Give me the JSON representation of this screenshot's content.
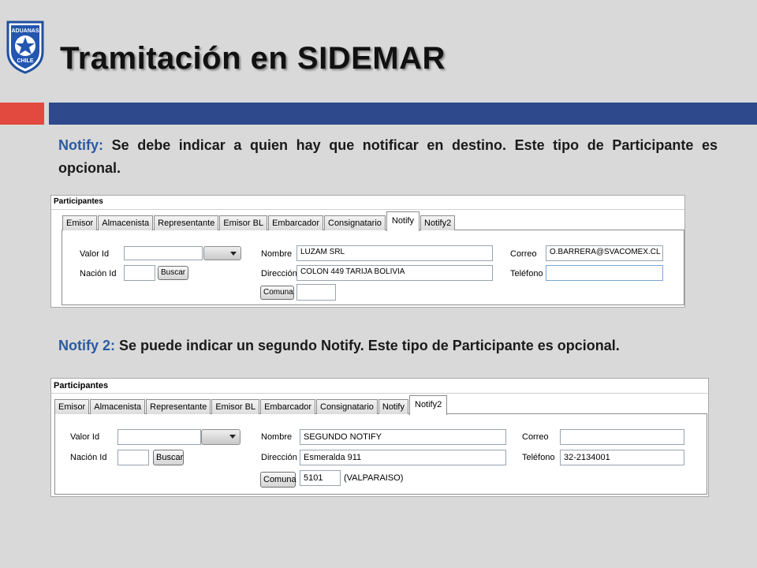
{
  "slide": {
    "title": "Tramitación en SIDEMAR",
    "logo_text_top": "ADUANAS",
    "logo_text_bottom": "CHILE",
    "colors": {
      "accent_red": "#e2493f",
      "accent_blue": "#2e4a8c",
      "keyword_blue": "#2c5aa0"
    }
  },
  "para1": {
    "keyword": "Notify:",
    "text": " Se debe indicar a quien hay que notificar en destino. Este tipo de Participante es opcional."
  },
  "para2": {
    "keyword": "Notify 2:",
    "text": " Se puede indicar un segundo Notify.  Este tipo de Participante es opcional."
  },
  "panel1": {
    "title": "Participantes",
    "tabs": [
      "Emisor",
      "Almacenista",
      "Representante",
      "Emisor BL",
      "Embarcador",
      "Consignatario",
      "Notify",
      "Notify2"
    ],
    "active_tab": "Notify",
    "labels": {
      "valor_id": "Valor Id",
      "nacion_id": "Nación Id",
      "nombre": "Nombre",
      "direccion": "Dirección",
      "correo": "Correo",
      "telefono": "Teléfono"
    },
    "buttons": {
      "buscar": "Buscar",
      "comuna": "Comuna"
    },
    "values": {
      "valor_id": "",
      "nacion_id": "",
      "nombre": "LUZAM SRL",
      "direccion": "COLON 449 TARIJA BOLIVIA",
      "correo": "O.BARRERA@SVACOMEX.CL",
      "telefono": "",
      "comuna": ""
    }
  },
  "panel2": {
    "title": "Participantes",
    "tabs": [
      "Emisor",
      "Almacenista",
      "Representante",
      "Emisor BL",
      "Embarcador",
      "Consignatario",
      "Notify",
      "Notify2"
    ],
    "active_tab": "Notify2",
    "labels": {
      "valor_id": "Valor Id",
      "nacion_id": "Nación Id",
      "nombre": "Nombre",
      "direccion": "Dirección",
      "correo": "Correo",
      "telefono": "Teléfono"
    },
    "buttons": {
      "buscar": "Buscar",
      "comuna": "Comuna"
    },
    "values": {
      "valor_id": "",
      "nacion_id": "",
      "nombre": "SEGUNDO NOTIFY",
      "direccion": "Esmeralda 911",
      "correo": "",
      "telefono": "32-2134001",
      "comuna": "5101",
      "comuna_name": "(VALPARAISO)"
    }
  }
}
